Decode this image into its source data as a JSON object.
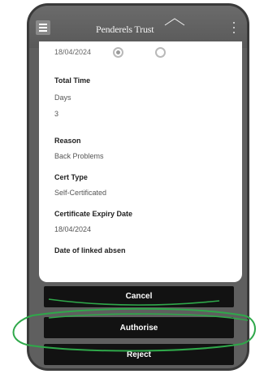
{
  "app_bar": {
    "brand_name": "Penderels Trust",
    "menu_icon": "hamburger-menu-icon",
    "overflow_icon": "kebab-menu-icon"
  },
  "form": {
    "cut_off_date": "18/04/2024",
    "radio_options": [
      {
        "selected": true
      },
      {
        "selected": false
      }
    ],
    "fields": [
      {
        "label": "Total Time",
        "values": [
          "Days",
          "3"
        ]
      },
      {
        "label": "Reason",
        "values": [
          "Back Problems"
        ]
      },
      {
        "label": "Cert Type",
        "values": [
          "Self-Certificated"
        ]
      },
      {
        "label": "Certificate Expiry Date",
        "values": [
          "18/04/2024"
        ]
      },
      {
        "label": "Date of linked absen",
        "values": []
      }
    ]
  },
  "actions": {
    "cancel_label": "Cancel",
    "authorise_label": "Authorise",
    "reject_label": "Reject"
  },
  "annotation": {
    "color": "#2fa84a"
  }
}
